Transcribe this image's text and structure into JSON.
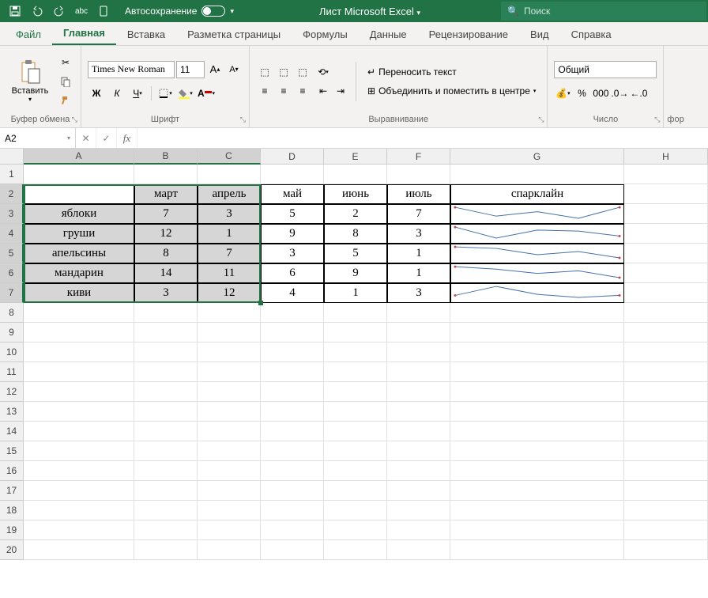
{
  "titlebar": {
    "autosave_label": "Автосохранение",
    "doc_title": "Лист Microsoft Excel",
    "search_placeholder": "Поиск"
  },
  "tabs": {
    "file": "Файл",
    "home": "Главная",
    "insert": "Вставка",
    "layout": "Разметка страницы",
    "formulas": "Формулы",
    "data": "Данные",
    "review": "Рецензирование",
    "view": "Вид",
    "help": "Справка"
  },
  "ribbon": {
    "paste": "Вставить",
    "clipboard": "Буфер обмена",
    "font_name": "Times New Roman",
    "font_size": "11",
    "font_group": "Шрифт",
    "alignment_group": "Выравнивание",
    "wrap": "Переносить текст",
    "merge": "Объединить и поместить в центре",
    "number_format": "Общий",
    "number_group": "Число",
    "truncated": "фор"
  },
  "formula_bar": {
    "name_box": "A2"
  },
  "grid": {
    "col_widths": {
      "A": 140,
      "B": 80,
      "C": 80,
      "D": 80,
      "E": 80,
      "F": 80,
      "G": 220,
      "H": 106
    },
    "columns": [
      "A",
      "B",
      "C",
      "D",
      "E",
      "F",
      "G",
      "H"
    ],
    "row_count": 20,
    "selected_cols": [
      "A",
      "B",
      "C"
    ],
    "selected_rows": [
      2,
      3,
      4,
      5,
      6,
      7
    ],
    "selection": "A2:C7",
    "headers": {
      "B2": "март",
      "C2": "апрель",
      "D2": "май",
      "E2": "июнь",
      "F2": "июль",
      "G2": "спарклайн"
    },
    "row_labels": {
      "A3": "яблоки",
      "A4": "груши",
      "A5": "апельсины",
      "A6": "мандарин",
      "A7": "киви"
    },
    "data": {
      "B3": "7",
      "C3": "3",
      "D3": "5",
      "E3": "2",
      "F3": "7",
      "B4": "12",
      "C4": "1",
      "D4": "9",
      "E4": "8",
      "F4": "3",
      "B5": "8",
      "C5": "7",
      "D5": "3",
      "E5": "5",
      "F5": "1",
      "B6": "14",
      "C6": "11",
      "D6": "6",
      "E6": "9",
      "F6": "1",
      "B7": "3",
      "C7": "12",
      "D7": "4",
      "E7": "1",
      "F7": "3"
    }
  },
  "chart_data": [
    {
      "type": "line",
      "row": 3,
      "x": [
        "март",
        "апрель",
        "май",
        "июнь",
        "июль"
      ],
      "values": [
        7,
        3,
        5,
        2,
        7
      ]
    },
    {
      "type": "line",
      "row": 4,
      "x": [
        "март",
        "апрель",
        "май",
        "июнь",
        "июль"
      ],
      "values": [
        12,
        1,
        9,
        8,
        3
      ]
    },
    {
      "type": "line",
      "row": 5,
      "x": [
        "март",
        "апрель",
        "май",
        "июнь",
        "июль"
      ],
      "values": [
        8,
        7,
        3,
        5,
        1
      ]
    },
    {
      "type": "line",
      "row": 6,
      "x": [
        "март",
        "апрель",
        "май",
        "июнь",
        "июль"
      ],
      "values": [
        14,
        11,
        6,
        9,
        1
      ]
    },
    {
      "type": "line",
      "row": 7,
      "x": [
        "март",
        "апрель",
        "май",
        "июнь",
        "июль"
      ],
      "values": [
        3,
        12,
        4,
        1,
        3
      ]
    }
  ]
}
